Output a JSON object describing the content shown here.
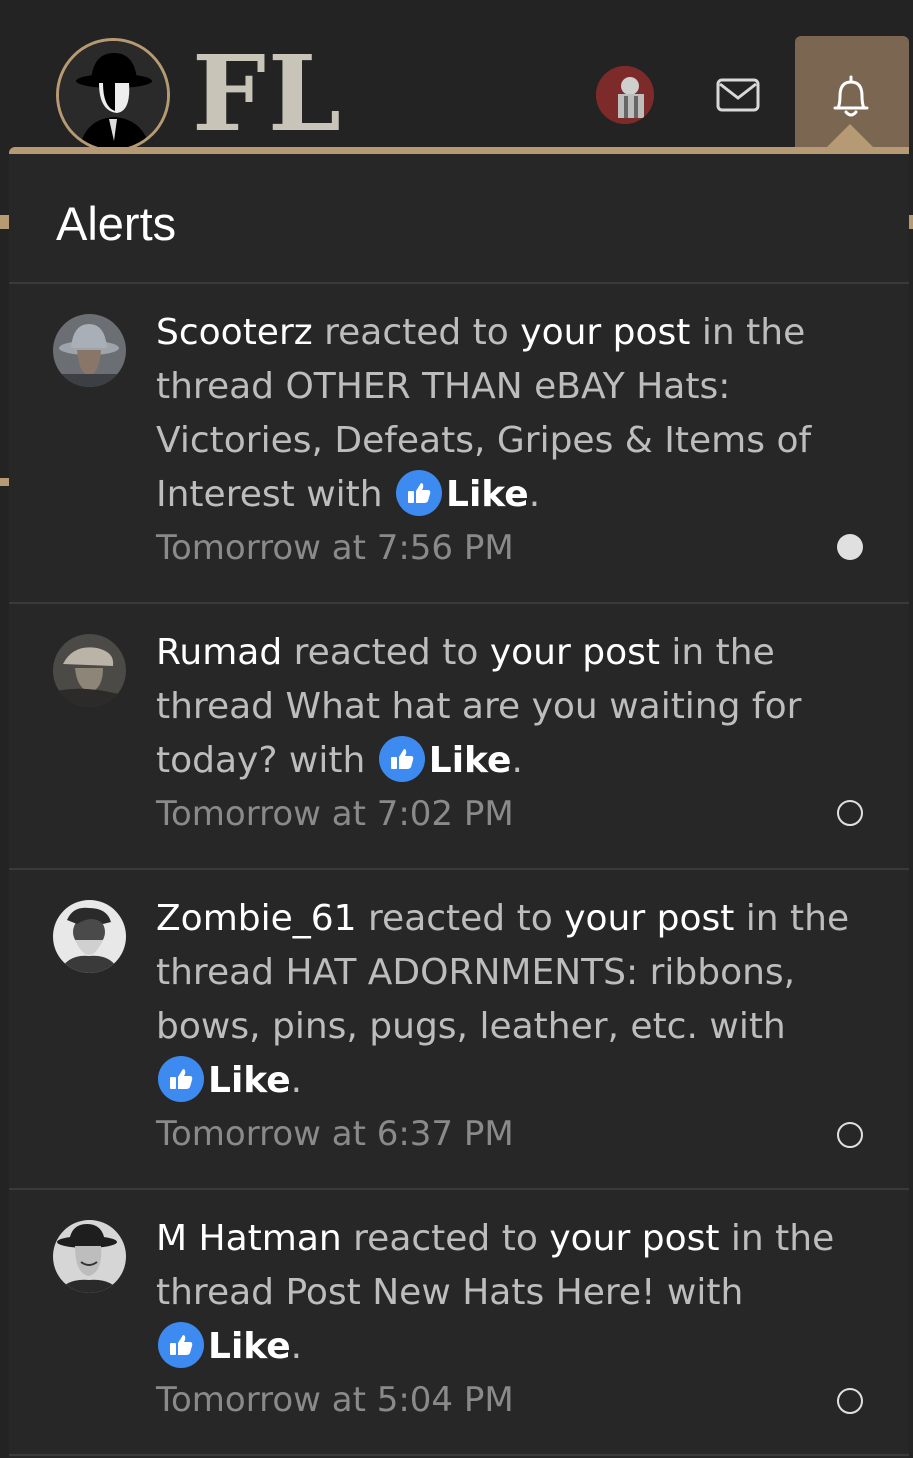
{
  "header": {
    "logo_text": "FL",
    "colors": {
      "accent": "#b69a73",
      "bell_bg": "#7a6651",
      "like_blue": "#3d8bf0"
    },
    "icons": [
      "user-avatar-icon",
      "mail-icon",
      "bell-icon"
    ]
  },
  "alerts_menu": {
    "title": "Alerts",
    "items": [
      {
        "user": "Scooterz",
        "reacted": "reacted to",
        "post": "your post",
        "in_thread": "in the thread",
        "thread": "OTHER THAN eBAY Hats: Victories, Defeats, Gripes & Items of Interest",
        "with": "with",
        "reaction": "Like",
        "period": ".",
        "time": "Tomorrow at 7:56 PM",
        "status": "unread"
      },
      {
        "user": "Rumad",
        "reacted": "reacted to",
        "post": "your post",
        "in_thread": "in the thread",
        "thread": "What hat are you waiting for today?",
        "with": "with",
        "reaction": "Like",
        "period": ".",
        "time": "Tomorrow at 7:02 PM",
        "status": "read"
      },
      {
        "user": "Zombie_61",
        "reacted": "reacted to",
        "post": "your post",
        "in_thread": "in the thread",
        "thread": "HAT ADORNMENTS: ribbons, bows, pins, pugs, leather, etc.",
        "with": "with",
        "reaction": "Like",
        "period": ".",
        "time": "Tomorrow at 6:37 PM",
        "status": "read"
      },
      {
        "user": "M Hatman",
        "reacted": "reacted to",
        "post": "your post",
        "in_thread": "in the thread",
        "thread": "Post New Hats Here!",
        "with": "with",
        "reaction": "Like",
        "period": ".",
        "time": "Tomorrow at 5:04 PM",
        "status": "read"
      }
    ]
  }
}
